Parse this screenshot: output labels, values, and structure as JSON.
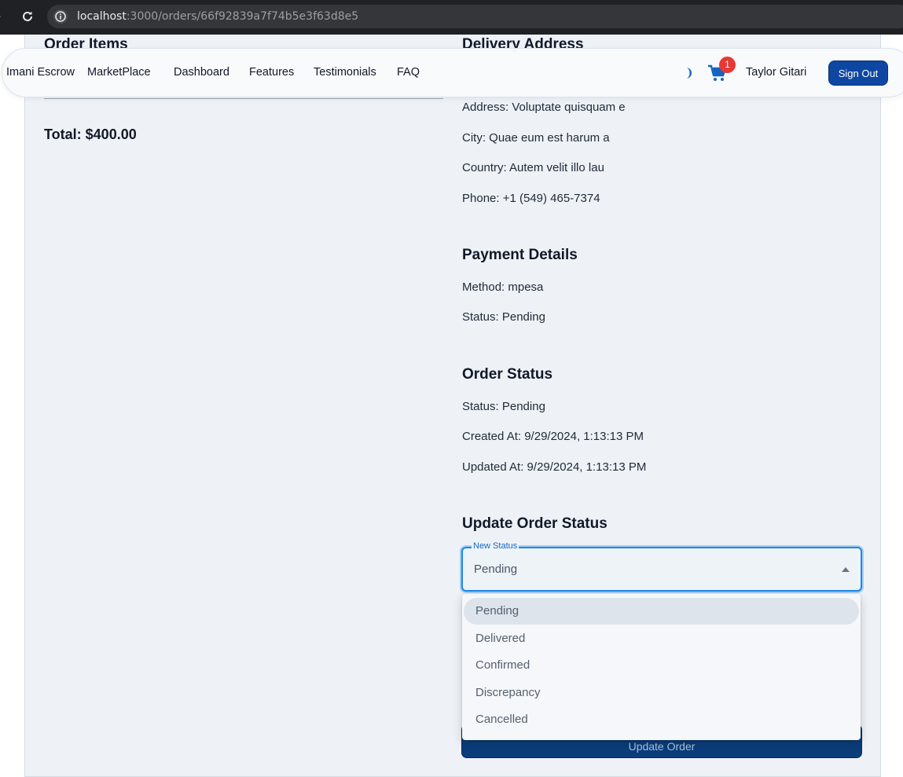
{
  "browser": {
    "url_host": "localhost",
    "url_path": ":3000/orders/66f92839a7f74b5e3f63d8e5"
  },
  "navbar": {
    "brand": "Imani Escrow",
    "links": [
      "MarketPlace",
      "Dashboard",
      "Features",
      "Testimonials",
      "FAQ"
    ],
    "cart_count": "1",
    "user_name": "Taylor Gitari",
    "sign_out_label": "Sign Out"
  },
  "order_items": {
    "title": "Order Items",
    "total": "Total: $400.00"
  },
  "delivery_address": {
    "title": "Delivery Address",
    "address": "Address: Voluptate quisquam e",
    "city": "City: Quae eum est harum a",
    "country": "Country: Autem velit illo lau",
    "phone": "Phone: +1 (549) 465-7374"
  },
  "payment_details": {
    "title": "Payment Details",
    "method": "Method: mpesa",
    "status": "Status: Pending"
  },
  "order_status": {
    "title": "Order Status",
    "status": "Status: Pending",
    "created_at": "Created At: 9/29/2024, 1:13:13 PM",
    "updated_at": "Updated At: 9/29/2024, 1:13:13 PM"
  },
  "update_order_status": {
    "title": "Update Order Status",
    "select_label": "New Status",
    "select_value": "Pending",
    "options": [
      "Pending",
      "Delivered",
      "Confirmed",
      "Discrepancy",
      "Cancelled"
    ],
    "selected_option": "Pending",
    "button_label": "Update Order"
  },
  "colors": {
    "accent": "#0d47a1",
    "focus": "#1e88e5",
    "badge": "#e53935",
    "card_bg": "#eef2f7"
  }
}
